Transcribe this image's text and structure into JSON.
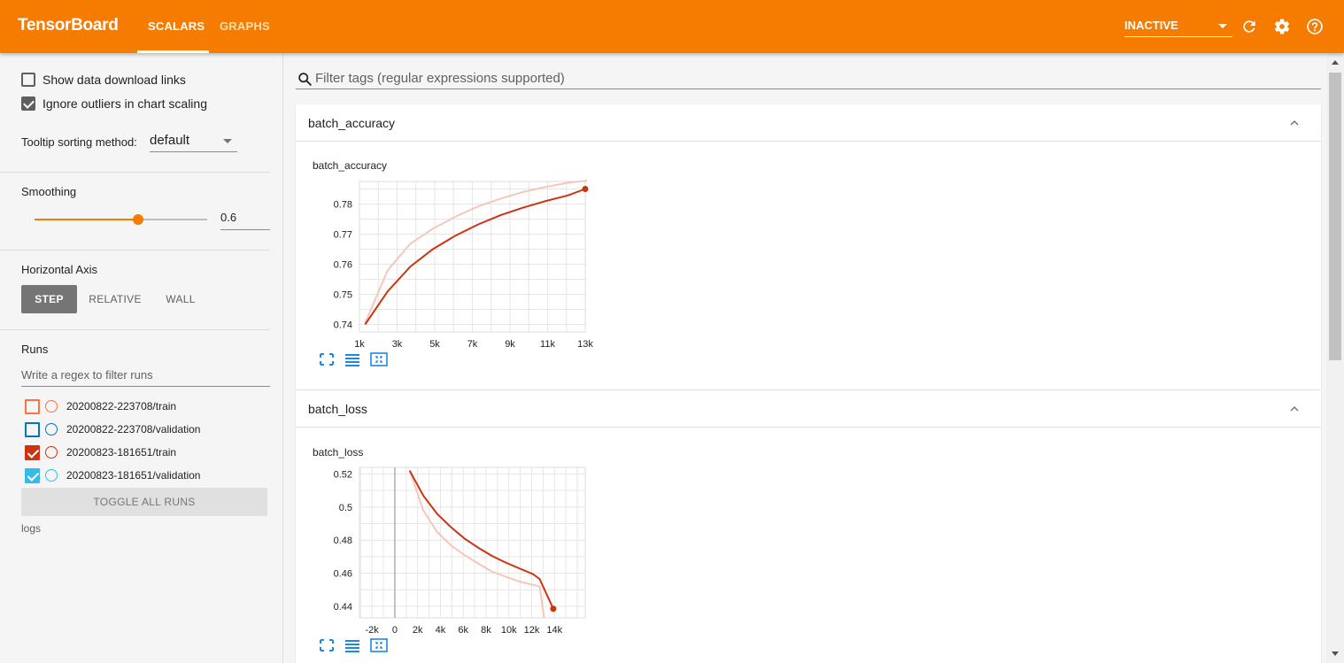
{
  "header": {
    "brand": "TensorBoard",
    "tabs": [
      {
        "label": "SCALARS",
        "active": true
      },
      {
        "label": "GRAPHS",
        "active": false
      }
    ],
    "status_select": "INACTIVE",
    "icons": [
      "refresh-icon",
      "settings-icon",
      "help-icon"
    ]
  },
  "sidebar": {
    "show_download_links": {
      "label": "Show data download links",
      "checked": false
    },
    "ignore_outliers": {
      "label": "Ignore outliers in chart scaling",
      "checked": true
    },
    "tooltip_sorting": {
      "label": "Tooltip sorting method:",
      "value": "default"
    },
    "smoothing": {
      "label": "Smoothing",
      "value": "0.6",
      "level": 0.6
    },
    "horizontal_axis": {
      "label": "Horizontal Axis",
      "options": [
        "STEP",
        "RELATIVE",
        "WALL"
      ],
      "selected": "STEP"
    },
    "runs": {
      "label": "Runs",
      "filter_placeholder": "Write a regex to filter runs",
      "items": [
        {
          "name": "20200822-223708/train",
          "checked": false,
          "color": "#ff7043"
        },
        {
          "name": "20200822-223708/validation",
          "checked": false,
          "color": "#0077bb"
        },
        {
          "name": "20200823-181651/train",
          "checked": true,
          "color": "#cc3311"
        },
        {
          "name": "20200823-181651/validation",
          "checked": true,
          "color": "#33bbee"
        }
      ],
      "toggle_label": "TOGGLE ALL RUNS",
      "logdir": "logs"
    }
  },
  "main": {
    "filter_placeholder": "Filter tags (regular expressions supported)",
    "cards": [
      {
        "title": "batch_accuracy",
        "chart_title": "batch_accuracy"
      },
      {
        "title": "batch_loss",
        "chart_title": "batch_loss"
      }
    ]
  },
  "chart_data": [
    {
      "type": "line",
      "title": "batch_accuracy",
      "xlim": [
        1000,
        13000
      ],
      "ylim": [
        0.7375,
        0.7875
      ],
      "xticks": [
        1000,
        3000,
        5000,
        7000,
        9000,
        11000,
        13000
      ],
      "xtick_labels": [
        "1k",
        "3k",
        "5k",
        "7k",
        "9k",
        "11k",
        "13k"
      ],
      "yticks": [
        0.74,
        0.75,
        0.76,
        0.77,
        0.78
      ],
      "ytick_labels": [
        "0.74",
        "0.75",
        "0.76",
        "0.77",
        "0.78"
      ],
      "grid": true,
      "series": [
        {
          "name": "20200823-181651/train",
          "kind": "raw",
          "color": "#f4c7bd",
          "x": [
            1300,
            2500,
            3700,
            4900,
            6100,
            7300,
            8500,
            9700,
            10900,
            12100,
            13100
          ],
          "y": [
            0.7405,
            0.758,
            0.7668,
            0.7718,
            0.7758,
            0.7792,
            0.7818,
            0.784,
            0.7857,
            0.7871,
            0.7878
          ]
        },
        {
          "name": "20200823-181651/train",
          "kind": "smoothed",
          "color": "#cc3311",
          "x": [
            1300,
            2500,
            3700,
            4900,
            6100,
            7300,
            8500,
            9700,
            10900,
            12100,
            13000
          ],
          "y": [
            0.74,
            0.751,
            0.7592,
            0.765,
            0.7695,
            0.7732,
            0.7763,
            0.7788,
            0.781,
            0.7829,
            0.785
          ]
        }
      ]
    },
    {
      "type": "line",
      "title": "batch_loss",
      "xlim": [
        -3100,
        16700
      ],
      "ylim": [
        0.433,
        0.524
      ],
      "xticks": [
        -2000,
        0,
        2000,
        4000,
        6000,
        8000,
        10000,
        12000,
        14000
      ],
      "xtick_labels": [
        "-2k",
        "0",
        "2k",
        "4k",
        "6k",
        "8k",
        "10k",
        "12k",
        "14k"
      ],
      "yticks": [
        0.44,
        0.46,
        0.48,
        0.5,
        0.52
      ],
      "ytick_labels": [
        "0.44",
        "0.46",
        "0.48",
        "0.5",
        "0.52"
      ],
      "grid": true,
      "series": [
        {
          "name": "20200823-181651/train",
          "kind": "raw",
          "color": "#f4c7bd",
          "x": [
            1300,
            2500,
            3700,
            4900,
            6100,
            7300,
            8500,
            9700,
            10900,
            12100,
            12700,
            13100
          ],
          "y": [
            0.522,
            0.498,
            0.485,
            0.477,
            0.471,
            0.466,
            0.461,
            0.458,
            0.455,
            0.453,
            0.452,
            0.433
          ]
        },
        {
          "name": "20200823-181651/train",
          "kind": "smoothed",
          "color": "#cc3311",
          "x": [
            1300,
            2500,
            3700,
            4900,
            6100,
            7300,
            8500,
            9700,
            10900,
            12100,
            12700,
            13900
          ],
          "y": [
            0.522,
            0.507,
            0.496,
            0.488,
            0.481,
            0.4755,
            0.4705,
            0.4665,
            0.463,
            0.4595,
            0.4565,
            0.4385
          ]
        }
      ]
    }
  ]
}
